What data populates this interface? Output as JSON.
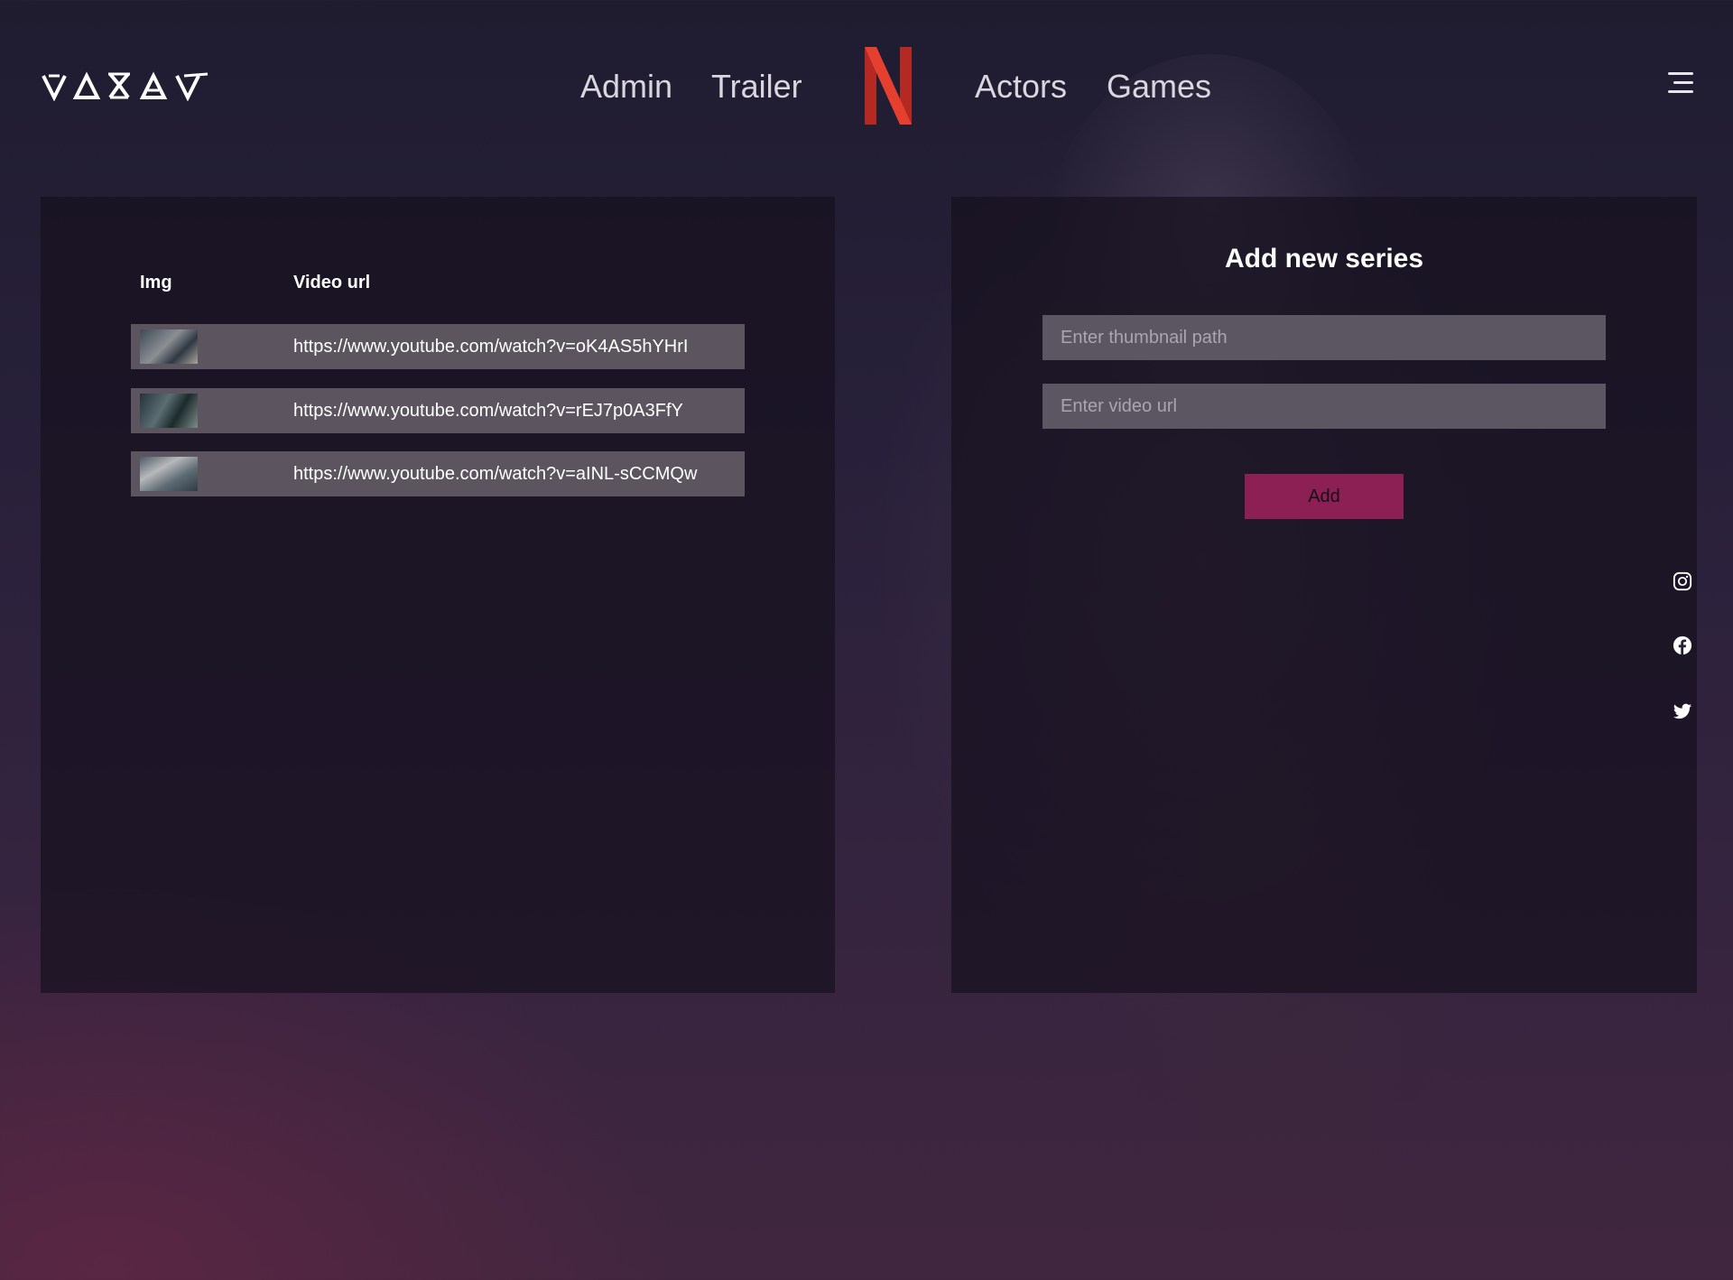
{
  "header": {
    "brand_logo": "witcher-wolf-logo",
    "center_logo": "netflix-n-logo",
    "nav": [
      {
        "label": "Admin"
      },
      {
        "label": "Trailer"
      },
      {
        "label": "Actors"
      },
      {
        "label": "Games"
      }
    ],
    "menu_icon": "hamburger-menu-icon"
  },
  "table": {
    "columns": [
      "Img",
      "Video url"
    ],
    "rows": [
      {
        "thumbnail": "series-thumbnail",
        "url": "https://www.youtube.com/watch?v=oK4AS5hYHrI"
      },
      {
        "thumbnail": "series-thumbnail",
        "url": "https://www.youtube.com/watch?v=rEJ7p0A3FfY"
      },
      {
        "thumbnail": "series-thumbnail",
        "url": "https://www.youtube.com/watch?v=aINL-sCCMQw"
      }
    ]
  },
  "form": {
    "title": "Add new series",
    "thumbnail_placeholder": "Enter thumbnail path",
    "video_placeholder": "Enter video url",
    "thumbnail_value": "",
    "video_value": "",
    "submit_label": "Add"
  },
  "social": [
    {
      "icon": "instagram-icon"
    },
    {
      "icon": "facebook-icon"
    },
    {
      "icon": "twitter-icon"
    }
  ],
  "colors": {
    "accent": "#8c1f53",
    "netflix_red": "#e5402f",
    "row_bg": "#5c5560",
    "input_bg": "#5b5661"
  }
}
